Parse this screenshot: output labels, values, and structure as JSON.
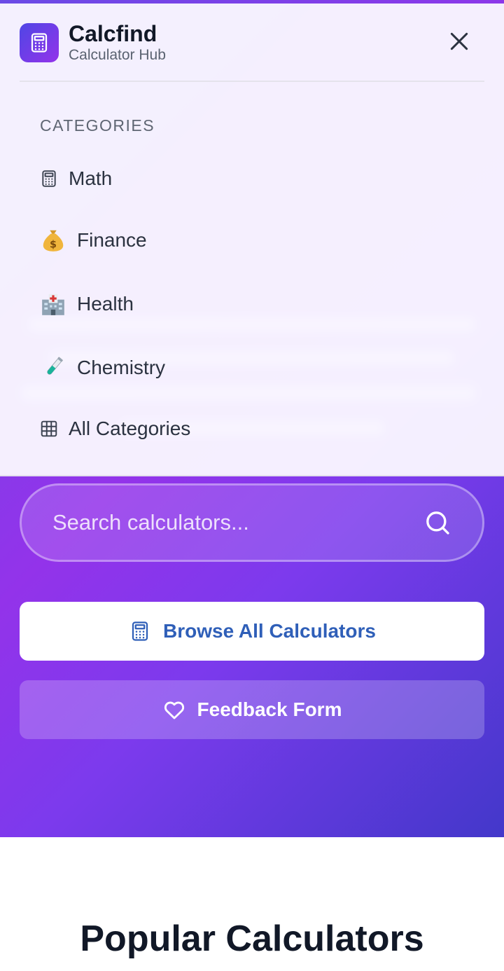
{
  "brand": {
    "name": "Calcfind",
    "subtitle": "Calculator Hub"
  },
  "menu": {
    "heading": "CATEGORIES",
    "items": [
      {
        "label": "Math",
        "icon": "calculator-icon"
      },
      {
        "label": "Finance",
        "icon": "money-bag-icon"
      },
      {
        "label": "Health",
        "icon": "hospital-icon"
      },
      {
        "label": "Chemistry",
        "icon": "test-tube-icon"
      },
      {
        "label": "All Categories",
        "icon": "grid-icon"
      }
    ]
  },
  "hero": {
    "search_placeholder": "Search calculators...",
    "browse_label": "Browse All Calculators",
    "feedback_label": "Feedback Form"
  },
  "popular": {
    "title": "Popular Calculators"
  },
  "colors": {
    "accent_start": "#4f46e5",
    "accent_end": "#9333ea",
    "primary_button_text": "#2f5fb8"
  }
}
